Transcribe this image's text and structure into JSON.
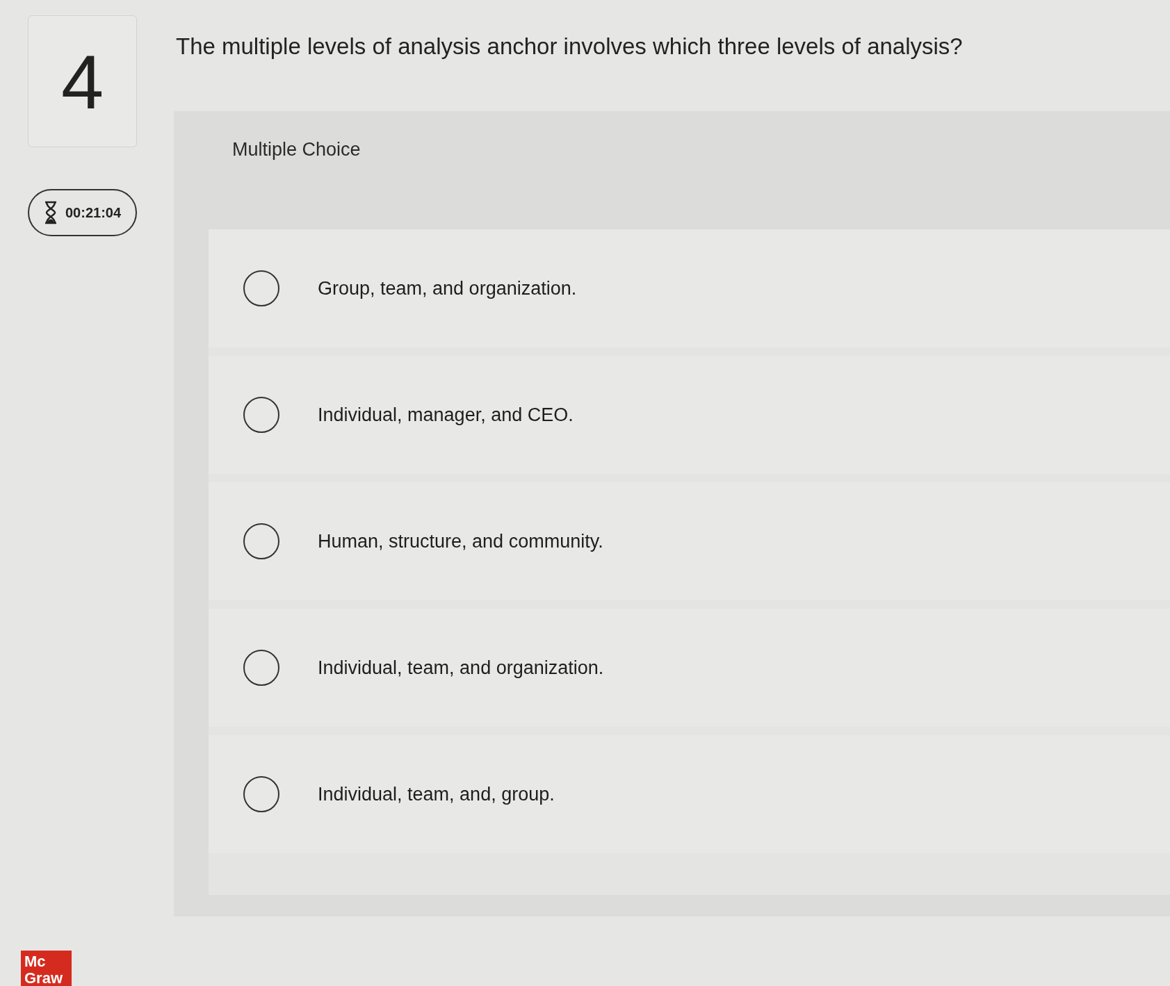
{
  "question": {
    "number": "4",
    "text": "The multiple levels of analysis anchor involves which three levels of analysis?"
  },
  "timer": {
    "time": "00:21:04"
  },
  "answer_panel": {
    "type_label": "Multiple Choice",
    "options": [
      {
        "label": "Group, team, and organization.",
        "selected": false
      },
      {
        "label": "Individual, manager, and CEO.",
        "selected": false
      },
      {
        "label": "Human, structure, and community.",
        "selected": false
      },
      {
        "label": "Individual, team, and organization.",
        "selected": false
      },
      {
        "label": "Individual, team, and, group.",
        "selected": false
      }
    ]
  },
  "logo": {
    "line_1": "Mc",
    "line_2": "Graw"
  }
}
